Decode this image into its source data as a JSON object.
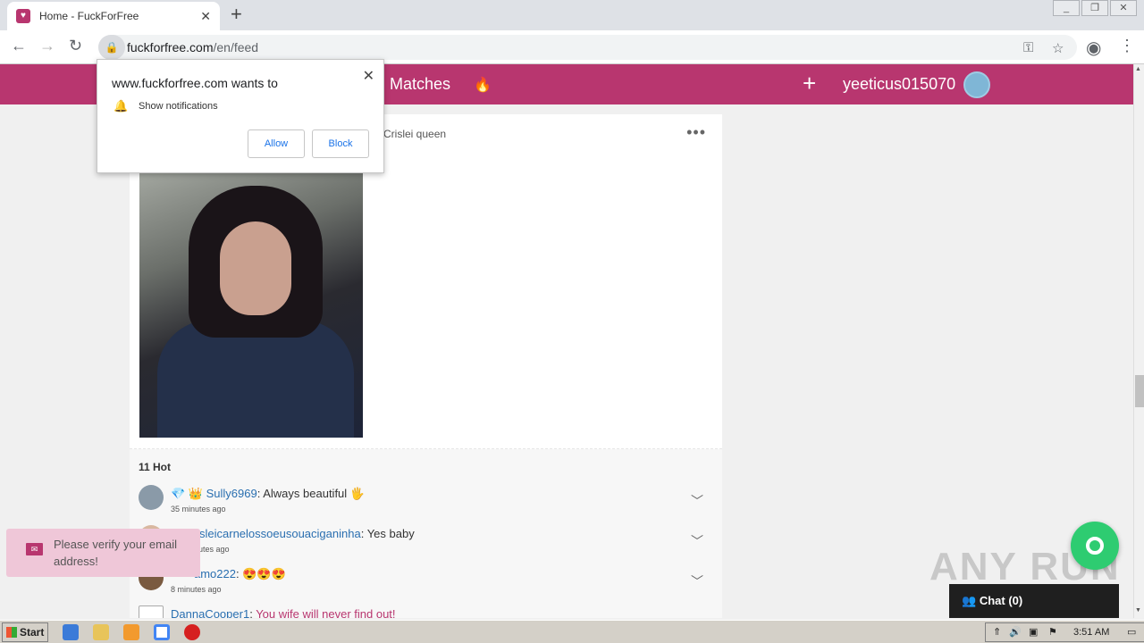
{
  "browser": {
    "tab_title": "Home - FuckForFree",
    "tab_close": "✕",
    "new_tab": "+",
    "url_domain": "fuckforfree.com",
    "url_path": "/en/feed"
  },
  "site": {
    "brand_color": "#b8366f",
    "nav_matches": "Matches",
    "fire_icon": "🔥",
    "add_icon": "+",
    "username": "yeeticus015070"
  },
  "notification_prompt": {
    "title": "www.fuckforfree.com wants to",
    "permission": "Show notifications",
    "allow": "Allow",
    "block": "Block",
    "close": "✕"
  },
  "post": {
    "poster": "Crislei queen",
    "more": "•••",
    "hot_count": "11 Hot",
    "comments": [
      {
        "badges": "💎 👑 ",
        "user": "Sully6969",
        "sep": ": ",
        "text": "Always beautiful 🖐",
        "time": "35 minutes ago"
      },
      {
        "badges": "",
        "user": "sleicarnelossoeusouaciganinha",
        "sep": ": ",
        "text": "Yes baby",
        "time": "nutes ago"
      },
      {
        "badges": "",
        "user": "amo222",
        "sep": ": ",
        "text": "😍😍😍",
        "time": "8 minutes ago"
      },
      {
        "badges": "",
        "user": "DannaCooper1",
        "sep": ": ",
        "text": "You wife will never find out!",
        "time": ""
      }
    ]
  },
  "toast": {
    "message": "Please verify your email address!"
  },
  "chat": {
    "label": "Chat (0)"
  },
  "watermark": "ANY RUN",
  "taskbar": {
    "start": "Start",
    "clock": "3:51 AM"
  }
}
